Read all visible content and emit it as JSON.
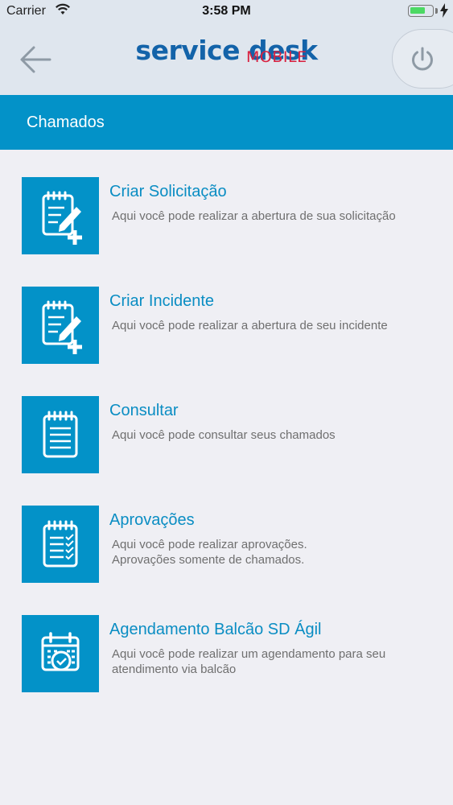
{
  "status_bar": {
    "carrier": "Carrier",
    "time": "3:58 PM",
    "battery_level": 0.7,
    "colors": {
      "battery": "#4cd964"
    }
  },
  "nav": {
    "back_icon": "back-arrow-icon",
    "logo_main": "service desk",
    "logo_sub": "MOBILE",
    "power_icon": "power-icon",
    "colors": {
      "logo_main": "#1363a9",
      "logo_sub": "#d8203f",
      "background": "#dfe6ee"
    }
  },
  "section": {
    "title": "Chamados",
    "color": "#0392c8"
  },
  "menu": [
    {
      "icon": "create-request-icon",
      "title": "Criar Solicitação",
      "description": "Aqui você pode realizar a abertura de sua solicitação"
    },
    {
      "icon": "create-incident-icon",
      "title": "Criar Incidente",
      "description": "Aqui você pode realizar a abertura de seu incidente"
    },
    {
      "icon": "consult-list-icon",
      "title": "Consultar",
      "description": "Aqui você pode consultar seus chamados"
    },
    {
      "icon": "approvals-checklist-icon",
      "title": "Aprovações",
      "description_lines": [
        "Aqui você pode realizar aprovações.",
        "Aprovações somente de chamados."
      ]
    },
    {
      "icon": "calendar-check-icon",
      "title": "Agendamento Balcão SD Ágil",
      "description": "Aqui você pode realizar um agendamento para seu atendimento via balcão"
    }
  ]
}
